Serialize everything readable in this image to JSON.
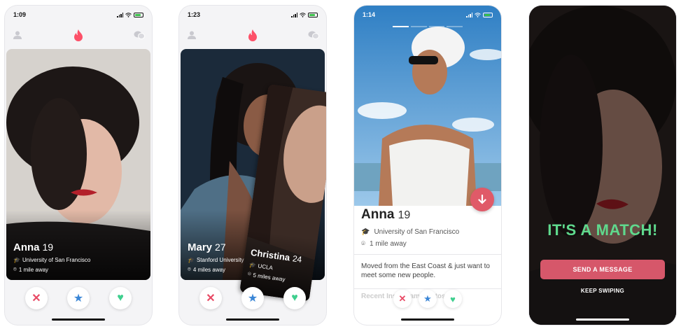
{
  "screens": [
    {
      "time": "1:09",
      "card": {
        "name": "Anna",
        "age": "19",
        "school": "University of San Francisco",
        "distance": "1 mile away"
      }
    },
    {
      "time": "1:23",
      "card": {
        "name": "Mary",
        "age": "27",
        "school": "Stanford University",
        "distance": "4 miles away"
      },
      "next_card": {
        "name": "Christina",
        "age": "24",
        "school": "UCLA",
        "distance": "5 miles away"
      }
    },
    {
      "time": "1:14",
      "profile": {
        "name": "Anna",
        "age": "19",
        "school": "University of San Francisco",
        "distance": "1 mile away",
        "bio": "Moved from the East Coast & just want to meet some new people.",
        "section_title": "Recent Instagram Photos"
      }
    },
    {
      "match": {
        "title": "IT'S A MATCH!",
        "send_label": "SEND A MESSAGE",
        "keep_label": "KEEP SWIPING"
      }
    }
  ],
  "colors": {
    "brand": "#fd5068",
    "match_green": "#5fd98d",
    "send_button": "#d6576a",
    "like": "#3fcf8e",
    "star": "#3a86d6",
    "nope": "#e84a65"
  },
  "icons": [
    "profile-icon",
    "flame-icon",
    "chat-icon",
    "close-icon",
    "star-icon",
    "heart-icon",
    "graduation-cap-icon",
    "location-pin-icon",
    "arrow-down-icon"
  ]
}
